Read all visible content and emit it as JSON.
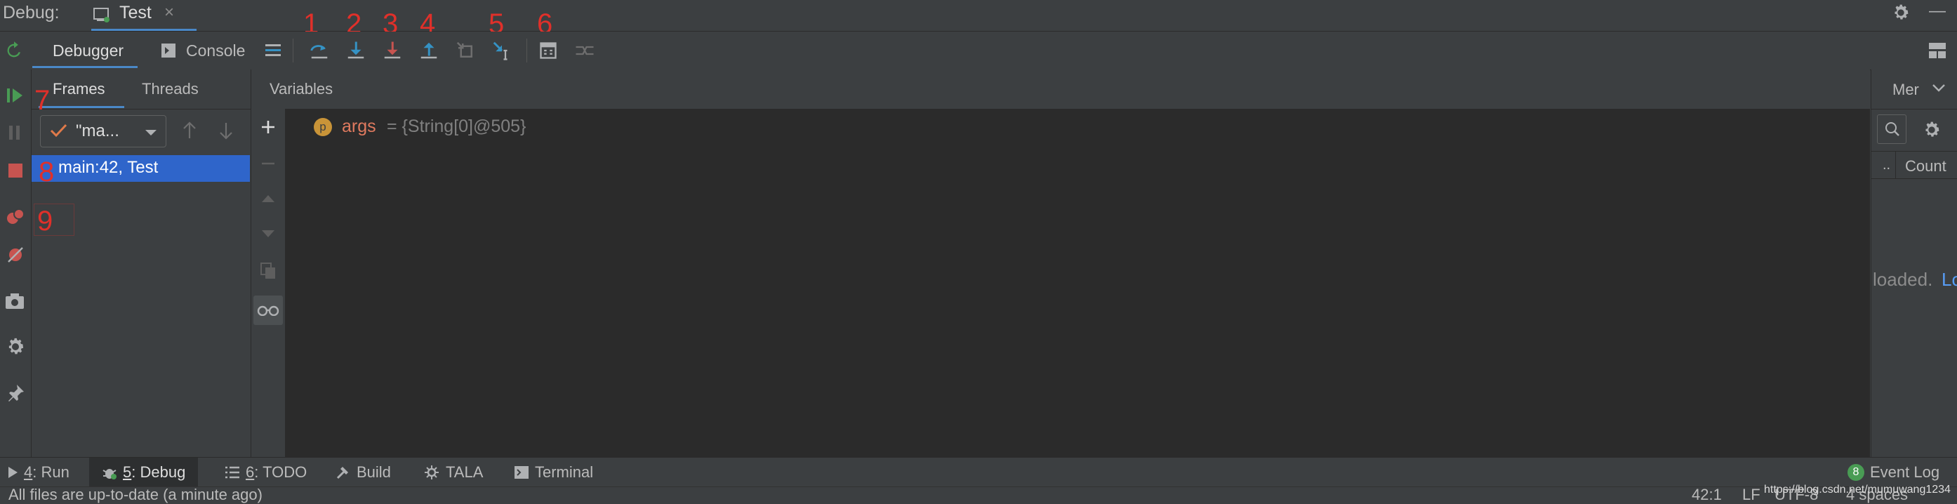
{
  "title_bar": {
    "label": "Debug:",
    "tab_name": "Test",
    "tab_close": "×",
    "minimize": "—"
  },
  "toolbar": {
    "debugger_tab": "Debugger",
    "console_tab": "Console"
  },
  "annotations": [
    "1",
    "2",
    "3",
    "4",
    "5",
    "6",
    "7",
    "8",
    "9"
  ],
  "frames": {
    "tabs": [
      "Frames",
      "Threads"
    ],
    "thread_combo": "\"ma...",
    "selected_frame": "main:42, Test"
  },
  "variables": {
    "header": "Variables",
    "items": [
      {
        "badge": "p",
        "name": "args",
        "value": "= {String[0]@505}"
      }
    ]
  },
  "memory": {
    "tab": "Mer",
    "col_dots": "..",
    "col_count": "Count",
    "loaded_text": "loaded.",
    "link_text": "Lo"
  },
  "bottom_tabs": [
    {
      "num": "4",
      "label": ": Run"
    },
    {
      "num": "5",
      "label": ": Debug"
    },
    {
      "num": "6",
      "label": ": TODO"
    },
    {
      "num": "",
      "label": "Build"
    },
    {
      "num": "",
      "label": "TALA"
    },
    {
      "num": "",
      "label": "Terminal"
    }
  ],
  "event_log": {
    "count": "8",
    "label": "Event Log"
  },
  "status": {
    "message": "All files are up-to-date (a minute ago)",
    "position": "42:1",
    "line_sep": "LF",
    "encoding": "UTF-8",
    "indent": "4 spaces",
    "watermark": "https://blog.csdn.net/mumuwang1234"
  },
  "colors": {
    "accent_red": "#e0302a",
    "selection_blue": "#2f65ca",
    "var_name": "#e07a5f",
    "var_value": "#808080",
    "step_icon_blue": "#3592c4",
    "run_green": "#499c54",
    "stop_red": "#c75450"
  }
}
